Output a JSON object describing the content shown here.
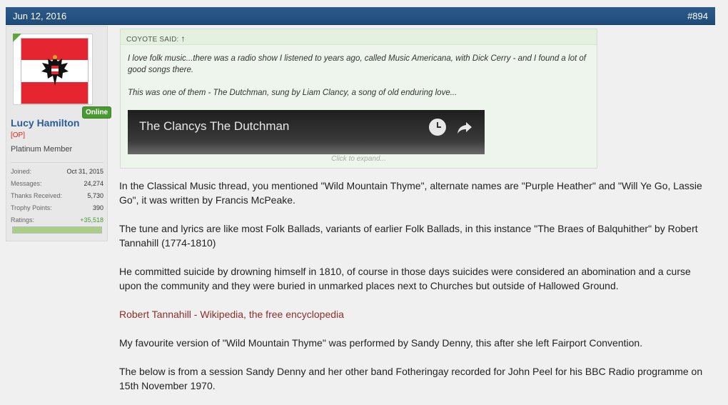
{
  "post": {
    "date": "Jun 12, 2016",
    "number": "#894"
  },
  "user": {
    "name": "Lucy Hamilton",
    "op_tag": "[OP]",
    "title": "Platinum Member",
    "online": "Online",
    "avatar": "austrian-flag-icon",
    "stats": [
      {
        "label": "Joined:",
        "value": "Oct 31, 2015"
      },
      {
        "label": "Messages:",
        "value": "24,274"
      },
      {
        "label": "Thanks Received:",
        "value": "5,730"
      },
      {
        "label": "Trophy Points:",
        "value": "390"
      },
      {
        "label": "Ratings:",
        "value": "+35,518"
      }
    ],
    "rating_fraction": 1.0
  },
  "quote": {
    "author_label": "COYOTE SAID:",
    "arrow": "↑",
    "lines": [
      "I love folk music...there was a radio show I listened to years ago, called Music Americana, with Dick Cerry - and I found a lot of good songs there.",
      "This was one of them - The Dutchman, sung by Liam Clancy, a song of old enduring love..."
    ],
    "video_title": "The Clancys The Dutchman",
    "expand": "Click to expand..."
  },
  "body": {
    "paragraphs": [
      "In the Classical Music thread, you mentioned \"Wild Mountain Thyme\", alternate names are \"Purple Heather\" and \"Will Ye Go, Lassie Go\", it was written by Francis McPeake.",
      "The tune and lyrics are like most Folk Ballads, variants of earlier Folk Ballads, in this instance \"The Braes of Balquhither\" by Robert Tannahill (1774-1810)",
      "He committed suicide by drowning himself in 1810, of course in those days suicides were considered an abomination and a curse upon the community and they were buried in unmarked places next to Churches but outside of Hallowed Ground.",
      "Robert Tannahill - Wikipedia, the free encyclopedia",
      "My favourite version of \"Wild Mountain Thyme\" was performed by Sandy Denny, this after she left Fairport Convention.",
      "The below is from a session Sandy Denny and her other band Fotheringay recorded for John Peel for his BBC Radio programme on 15th November 1970."
    ]
  },
  "colors": {
    "header": "#1f4b7b",
    "link": "#8a2f2a",
    "online": "#4a9a32"
  }
}
